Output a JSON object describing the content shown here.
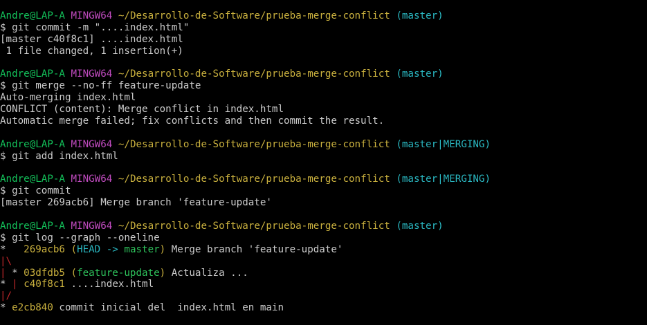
{
  "colors": {
    "background": "#000000",
    "user_host": "#13c15a",
    "msystem": "#c04bbf",
    "path": "#c9b03e",
    "branch": "#2ab7c1",
    "text": "#cccccc",
    "graph_red": "#c0282b",
    "graph_green": "#2ec35c"
  },
  "lines": [
    {
      "segments": [
        {
          "text": "Andre@LAP-A",
          "color": "green"
        },
        {
          "text": " ",
          "color": "white"
        },
        {
          "text": "MINGW64",
          "color": "magenta"
        },
        {
          "text": " ",
          "color": "white"
        },
        {
          "text": "~/Desarrollo-de-Software/prueba-merge-conflict",
          "color": "yellow"
        },
        {
          "text": " (master)",
          "color": "cyan"
        }
      ]
    },
    {
      "segments": [
        {
          "text": "$ git commit -m \"....index.html\"",
          "color": "white"
        }
      ]
    },
    {
      "segments": [
        {
          "text": "[master c40f8c1] ....index.html",
          "color": "white"
        }
      ]
    },
    {
      "segments": [
        {
          "text": " 1 file changed, 1 insertion(+)",
          "color": "white"
        }
      ]
    },
    {
      "segments": []
    },
    {
      "segments": [
        {
          "text": "Andre@LAP-A",
          "color": "green"
        },
        {
          "text": " ",
          "color": "white"
        },
        {
          "text": "MINGW64",
          "color": "magenta"
        },
        {
          "text": " ",
          "color": "white"
        },
        {
          "text": "~/Desarrollo-de-Software/prueba-merge-conflict",
          "color": "yellow"
        },
        {
          "text": " (master)",
          "color": "cyan"
        }
      ]
    },
    {
      "segments": [
        {
          "text": "$ git merge --no-ff feature-update",
          "color": "white"
        }
      ]
    },
    {
      "segments": [
        {
          "text": "Auto-merging index.html",
          "color": "white"
        }
      ]
    },
    {
      "segments": [
        {
          "text": "CONFLICT (content): Merge conflict in index.html",
          "color": "white"
        }
      ]
    },
    {
      "segments": [
        {
          "text": "Automatic merge failed; fix conflicts and then commit the result.",
          "color": "white"
        }
      ]
    },
    {
      "segments": []
    },
    {
      "segments": [
        {
          "text": "Andre@LAP-A",
          "color": "green"
        },
        {
          "text": " ",
          "color": "white"
        },
        {
          "text": "MINGW64",
          "color": "magenta"
        },
        {
          "text": " ",
          "color": "white"
        },
        {
          "text": "~/Desarrollo-de-Software/prueba-merge-conflict",
          "color": "yellow"
        },
        {
          "text": " (master|MERGING)",
          "color": "cyan"
        }
      ]
    },
    {
      "segments": [
        {
          "text": "$ git add index.html",
          "color": "white"
        }
      ]
    },
    {
      "segments": []
    },
    {
      "segments": [
        {
          "text": "Andre@LAP-A",
          "color": "green"
        },
        {
          "text": " ",
          "color": "white"
        },
        {
          "text": "MINGW64",
          "color": "magenta"
        },
        {
          "text": " ",
          "color": "white"
        },
        {
          "text": "~/Desarrollo-de-Software/prueba-merge-conflict",
          "color": "yellow"
        },
        {
          "text": " (master|MERGING)",
          "color": "cyan"
        }
      ]
    },
    {
      "segments": [
        {
          "text": "$ git commit",
          "color": "white"
        }
      ]
    },
    {
      "segments": [
        {
          "text": "[master 269acb6] Merge branch 'feature-update'",
          "color": "white"
        }
      ]
    },
    {
      "segments": []
    },
    {
      "segments": [
        {
          "text": "Andre@LAP-A",
          "color": "green"
        },
        {
          "text": " ",
          "color": "white"
        },
        {
          "text": "MINGW64",
          "color": "magenta"
        },
        {
          "text": " ",
          "color": "white"
        },
        {
          "text": "~/Desarrollo-de-Software/prueba-merge-conflict",
          "color": "yellow"
        },
        {
          "text": " (master)",
          "color": "cyan"
        }
      ]
    },
    {
      "segments": [
        {
          "text": "$ git log --graph --oneline",
          "color": "white"
        }
      ]
    },
    {
      "segments": [
        {
          "text": "*   ",
          "color": "white"
        },
        {
          "text": "269acb6",
          "color": "yellow"
        },
        {
          "text": " (",
          "color": "yellow"
        },
        {
          "text": "HEAD -> ",
          "color": "cyan"
        },
        {
          "text": "master",
          "color": "green2"
        },
        {
          "text": ")",
          "color": "yellow"
        },
        {
          "text": " Merge branch 'feature-update'",
          "color": "white"
        }
      ]
    },
    {
      "segments": [
        {
          "text": "|\\",
          "color": "red"
        }
      ]
    },
    {
      "segments": [
        {
          "text": "|",
          "color": "red"
        },
        {
          "text": " * ",
          "color": "white"
        },
        {
          "text": "03dfdb5",
          "color": "yellow"
        },
        {
          "text": " (",
          "color": "yellow"
        },
        {
          "text": "feature-update",
          "color": "green2"
        },
        {
          "text": ")",
          "color": "yellow"
        },
        {
          "text": " Actualiza ...",
          "color": "white"
        }
      ]
    },
    {
      "segments": [
        {
          "text": "* ",
          "color": "white"
        },
        {
          "text": "|",
          "color": "red"
        },
        {
          "text": " ",
          "color": "white"
        },
        {
          "text": "c40f8c1",
          "color": "yellow"
        },
        {
          "text": " ....index.html",
          "color": "white"
        }
      ]
    },
    {
      "segments": [
        {
          "text": "|/",
          "color": "red"
        }
      ]
    },
    {
      "segments": [
        {
          "text": "* ",
          "color": "white"
        },
        {
          "text": "e2cb840",
          "color": "yellow"
        },
        {
          "text": " commit inicial del  index.html en main",
          "color": "white"
        }
      ]
    }
  ]
}
